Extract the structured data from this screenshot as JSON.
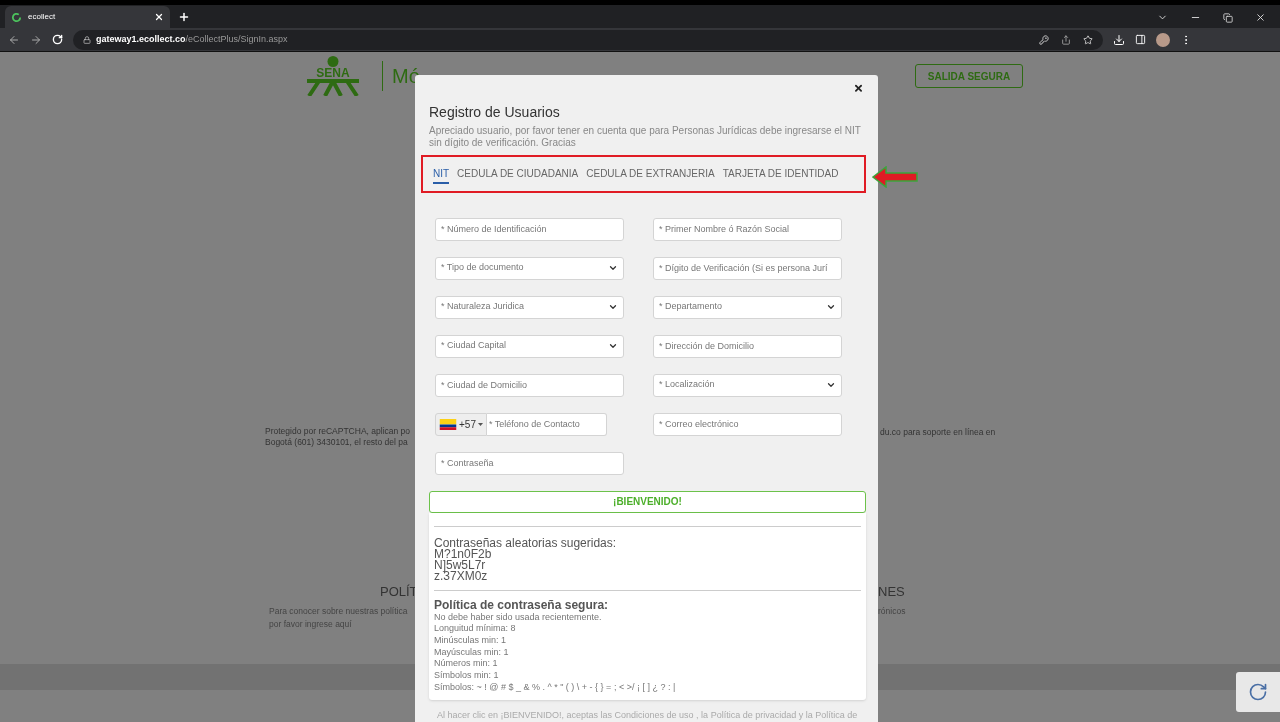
{
  "browser": {
    "tab_title": "ecollect",
    "url_host": "gateway1.ecollect.co",
    "url_path": "/eCollectPlus/SignIn.aspx"
  },
  "header": {
    "logo_text": "SENA",
    "title_fragment": "Mó",
    "exit_button": "SALIDA SEGURA"
  },
  "background": {
    "recaptcha_left": [
      "Protegido por reCAPTCHA, aplican po",
      "Bogotá (601) 3430101, el resto del pa"
    ],
    "recaptcha_right": "du.co para soporte en línea en",
    "policies_heading_left": "POLÍT",
    "policies_text_left": [
      "Para conocer sobre nuestras política",
      "por favor ingrese aquí"
    ],
    "policies_heading_right": "NES",
    "policies_text_right": "rónicos"
  },
  "modal": {
    "title": "Registro de Usuarios",
    "notice": "Apreciado usuario, por favor tener en cuenta que para Personas Jurídicas debe ingresarse el NIT sin dígito de verificación. Gracias",
    "tabs": [
      {
        "label": "NIT",
        "selected": true
      },
      {
        "label": "CEDULA DE CIUDADANIA",
        "selected": false
      },
      {
        "label": "CEDULA DE EXTRANJERIA",
        "selected": false
      },
      {
        "label": "TARJETA DE IDENTIDAD",
        "selected": false
      }
    ],
    "fields": [
      {
        "kind": "input",
        "placeholder": "* Número de Identificación"
      },
      {
        "kind": "input",
        "placeholder": "* Primer Nombre ó Razón Social"
      },
      {
        "kind": "select",
        "placeholder": "* Tipo de documento"
      },
      {
        "kind": "input",
        "placeholder": "* Dígito de Verificación (Si es persona Jurí"
      },
      {
        "kind": "select",
        "placeholder": "* Naturaleza Juridica"
      },
      {
        "kind": "select",
        "placeholder": "* Departamento"
      },
      {
        "kind": "select",
        "placeholder": "* Ciudad Capital"
      },
      {
        "kind": "input",
        "placeholder": "* Dirección de Domicilio"
      },
      {
        "kind": "input",
        "placeholder": "* Ciudad de Domicilio"
      },
      {
        "kind": "select",
        "placeholder": "* Localización"
      },
      {
        "kind": "phone",
        "code": "+57",
        "placeholder": "* Teléfono de Contacto"
      },
      {
        "kind": "input",
        "placeholder": "* Correo electrónico"
      },
      {
        "kind": "password",
        "placeholder": "* Contraseña"
      }
    ],
    "submit": "¡BIENVENIDO!",
    "suggestions": {
      "heading": "Contraseñas aleatorias sugeridas:",
      "passwords": [
        "M?1n0F2b",
        "N]5w5L7r",
        "z.37XM0z"
      ]
    },
    "policy": {
      "heading": "Política de contraseña segura:",
      "rules": [
        "No debe haber sido usada recientemente.",
        "Longuitud mínima: 8",
        "Minúsculas min: 1",
        "Mayúsculas min: 1",
        "Números min: 1",
        "Símbolos min: 1",
        "Símbolos: ~ ! @ # $ _ & % . ^ * \" ( ) \\ + - { } = ; < >/ ¡ [ ] ¿ ? : |"
      ]
    },
    "footer_note": "Al hacer clic en ¡BIENVENIDO!, aceptas las Condiciones de uso , la Política de privacidad y la Política de"
  }
}
